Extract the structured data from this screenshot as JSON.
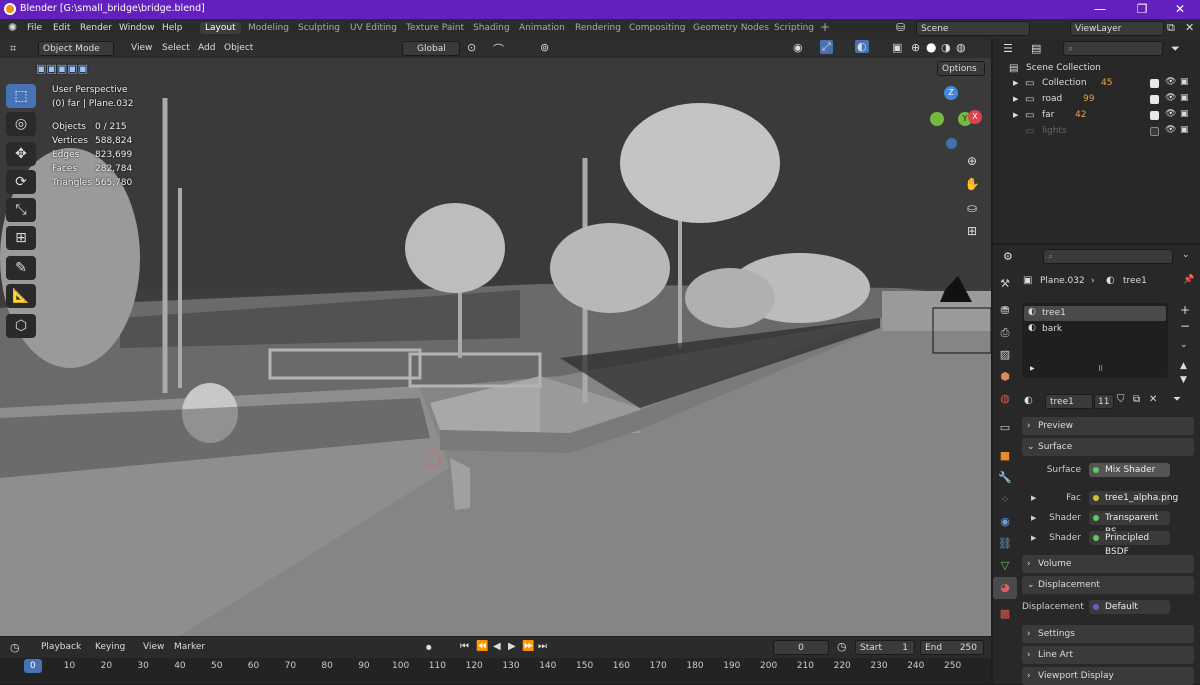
{
  "window": {
    "title": "Blender [G:\\small_bridge\\bridge.blend]",
    "controls": [
      "—",
      "❐",
      "✕"
    ]
  },
  "menu": {
    "items": [
      "File",
      "Edit",
      "Render",
      "Window",
      "Help"
    ],
    "workspaces": [
      "Layout",
      "Modeling",
      "Sculpting",
      "UV Editing",
      "Texture Paint",
      "Shading",
      "Animation",
      "Rendering",
      "Compositing",
      "Geometry Nodes",
      "Scripting"
    ],
    "scene": "Scene",
    "view_layer": "ViewLayer"
  },
  "viewport_header": {
    "mode": "Object Mode",
    "menus": [
      "View",
      "Select",
      "Add",
      "Object"
    ],
    "transform": "Global",
    "options": "Options"
  },
  "overlay": {
    "view_name": "User Perspective",
    "context": "(0) far | Plane.032",
    "stats": [
      {
        "label": "Objects",
        "value": "0 / 215"
      },
      {
        "label": "Vertices",
        "value": "588,824"
      },
      {
        "label": "Edges",
        "value": "823,699"
      },
      {
        "label": "Faces",
        "value": "282,784"
      },
      {
        "label": "Triangles",
        "value": "565,780"
      }
    ]
  },
  "gizmo": {
    "z": "Z",
    "y": "Y",
    "x": "X"
  },
  "outliner": {
    "root": "Scene Collection",
    "items": [
      {
        "name": "Collection",
        "count": "45"
      },
      {
        "name": "road",
        "count": "99"
      },
      {
        "name": "far",
        "count": "42"
      },
      {
        "name": "lights",
        "count": ""
      }
    ]
  },
  "properties": {
    "object": "Plane.032",
    "material": "tree1",
    "slots": [
      "tree1",
      "bark"
    ],
    "material_field": "tree1",
    "users": "11",
    "panels": {
      "preview": "Preview",
      "surface": "Surface",
      "volume": "Volume",
      "displacement": "Displacement",
      "settings": "Settings",
      "line_art": "Line Art",
      "viewport_display": "Viewport Display"
    },
    "surface": {
      "label": "Surface",
      "value": "Mix Shader"
    },
    "fac": {
      "label": "Fac",
      "value": "tree1_alpha.png"
    },
    "shader1": {
      "label": "Shader",
      "value": "Transparent BS..."
    },
    "shader2": {
      "label": "Shader",
      "value": "Principled BSDF"
    },
    "disp": {
      "label": "Displacement",
      "value": "Default"
    }
  },
  "timeline": {
    "menus": [
      "Playback",
      "Keying",
      "View",
      "Marker"
    ],
    "current_frame": "0",
    "start_label": "Start",
    "start": "1",
    "end_label": "End",
    "end": "250",
    "ticks": [
      "0",
      "10",
      "20",
      "30",
      "40",
      "50",
      "60",
      "70",
      "80",
      "90",
      "100",
      "110",
      "120",
      "130",
      "140",
      "150",
      "160",
      "170",
      "180",
      "190",
      "200",
      "210",
      "220",
      "230",
      "240",
      "250"
    ]
  },
  "colors": {
    "accent": "#4772b3",
    "title_bar": "#6420bf",
    "x_axis": "#e0414f",
    "y_axis": "#75b842",
    "z_axis": "#4488e0"
  }
}
